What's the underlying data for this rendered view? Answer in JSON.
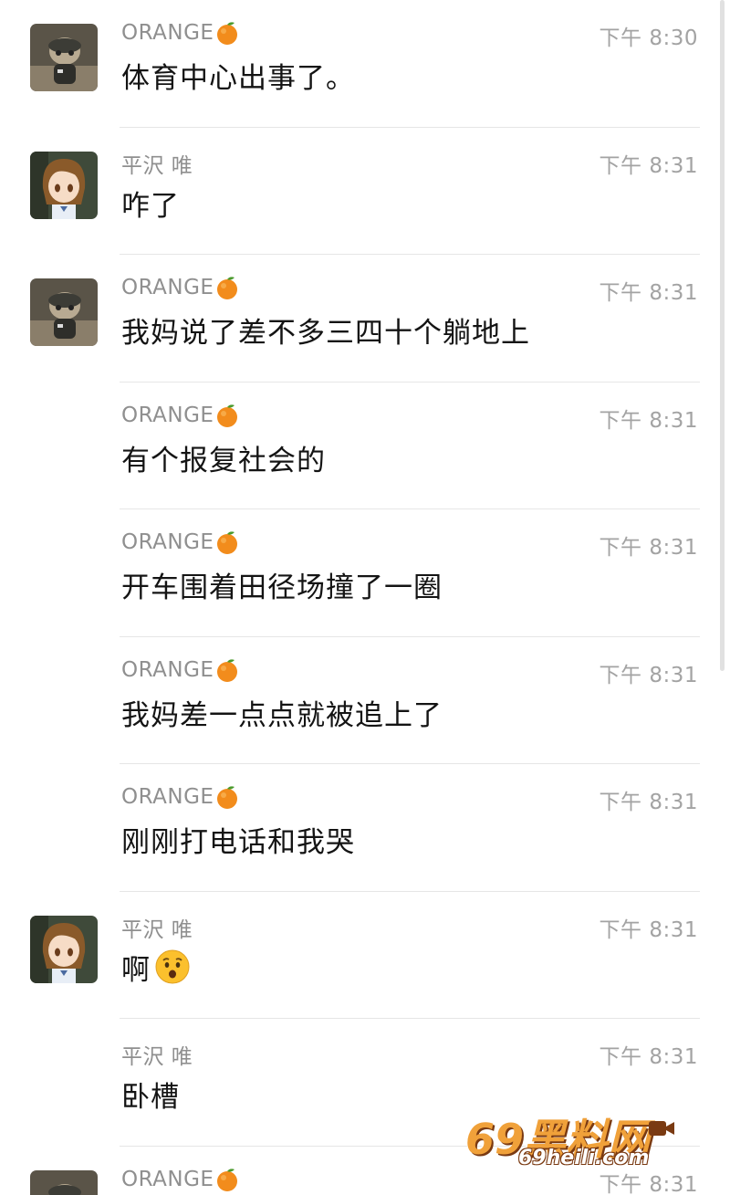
{
  "messages": [
    {
      "sender": "ORANGE",
      "avatar": "cat-avatar",
      "time": "下午 8:30",
      "text": "体育中心出事了。",
      "emoji": ""
    },
    {
      "sender": "平沢 唯",
      "avatar": "girl-avatar",
      "time": "下午 8:31",
      "text": "咋了",
      "emoji": ""
    },
    {
      "sender": "ORANGE",
      "avatar": "cat-avatar",
      "time": "下午 8:31",
      "text": "我妈说了差不多三四十个躺地上",
      "emoji": ""
    },
    {
      "sender": "ORANGE",
      "avatar": "",
      "time": "下午 8:31",
      "text": "有个报复社会的",
      "emoji": ""
    },
    {
      "sender": "ORANGE",
      "avatar": "",
      "time": "下午 8:31",
      "text": "开车围着田径场撞了一圈",
      "emoji": ""
    },
    {
      "sender": "ORANGE",
      "avatar": "",
      "time": "下午 8:31",
      "text": "我妈差一点点就被追上了",
      "emoji": ""
    },
    {
      "sender": "ORANGE",
      "avatar": "",
      "time": "下午 8:31",
      "text": "刚刚打电话和我哭",
      "emoji": ""
    },
    {
      "sender": "平沢 唯",
      "avatar": "girl-avatar",
      "time": "下午 8:31",
      "text": "啊",
      "emoji": "astonished-face-icon"
    },
    {
      "sender": "平沢 唯",
      "avatar": "",
      "time": "下午 8:31",
      "text": "卧槽",
      "emoji": ""
    },
    {
      "sender": "ORANGE",
      "avatar": "cat-avatar",
      "time": "下午 8:31",
      "text": "",
      "emoji": ""
    }
  ],
  "watermark": {
    "main": "69黑料网",
    "sub": "69heili.com"
  },
  "colors": {
    "sender": "#8f8f8f",
    "time": "#a3a3a3",
    "text": "#141414",
    "divider": "#e6e6e6",
    "watermark": "#f0a13a"
  }
}
